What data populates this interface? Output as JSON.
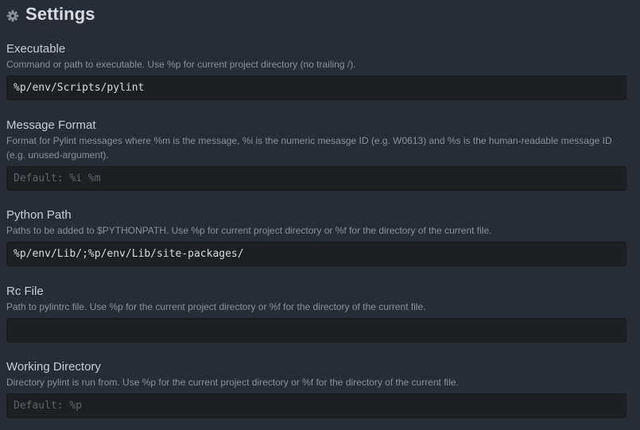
{
  "header": {
    "title": "Settings",
    "icon": "gear-icon"
  },
  "settings": [
    {
      "label": "Executable",
      "description": "Command or path to executable. Use %p for current project directory (no trailing /).",
      "value": "%p/env/Scripts/pylint",
      "placeholder": ""
    },
    {
      "label": "Message Format",
      "description": "Format for Pylint messages where %m is the message, %i is the numeric mesasge ID (e.g. W0613) and %s is the human-readable message ID (e.g. unused-argument).",
      "value": "",
      "placeholder": "Default: %i %m"
    },
    {
      "label": "Python Path",
      "description": "Paths to be added to $PYTHONPATH. Use %p for current project directory or %f for the directory of the current file.",
      "value": "%p/env/Lib/;%p/env/Lib/site-packages/",
      "placeholder": ""
    },
    {
      "label": "Rc File",
      "description": "Path to pylintrc file. Use %p for the current project directory or %f for the directory of the current file.",
      "value": "",
      "placeholder": ""
    },
    {
      "label": "Working Directory",
      "description": "Directory pylint is run from. Use %p for the current project directory or %f for the directory of the current file.",
      "value": "",
      "placeholder": "Default: %p"
    }
  ]
}
